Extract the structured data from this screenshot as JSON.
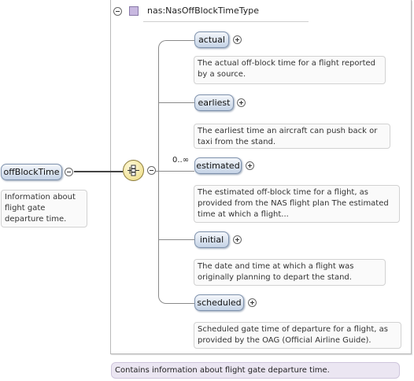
{
  "complex_type": {
    "name": "nas:NasOffBlockTimeType"
  },
  "root_element": {
    "name": "offBlockTime",
    "doc": "Information about flight gate departure time."
  },
  "sequence": {
    "occurrence": "0..∞"
  },
  "children": [
    {
      "name": "actual",
      "doc": "The actual off-block time for a flight reported by a source."
    },
    {
      "name": "earliest",
      "doc": "The earliest time an aircraft can push back or taxi from the stand."
    },
    {
      "name": "estimated",
      "doc": "The estimated off-block time for a flight, as provided from the NAS flight plan The estimated time at which a flight..."
    },
    {
      "name": "initial",
      "doc": "The date and time at which a flight was originally planning to depart the stand."
    },
    {
      "name": "scheduled",
      "doc": "Scheduled gate time of departure for a flight, as provided by the OAG (Official Airline Guide)."
    }
  ],
  "type_doc": "Contains information about flight gate departure time.",
  "colors": {
    "pill_border": "#7f92ad",
    "type_icon": "#c8b8e0",
    "sequence_fill": "#ecd97a",
    "footer_bg": "#ebe6f2"
  }
}
